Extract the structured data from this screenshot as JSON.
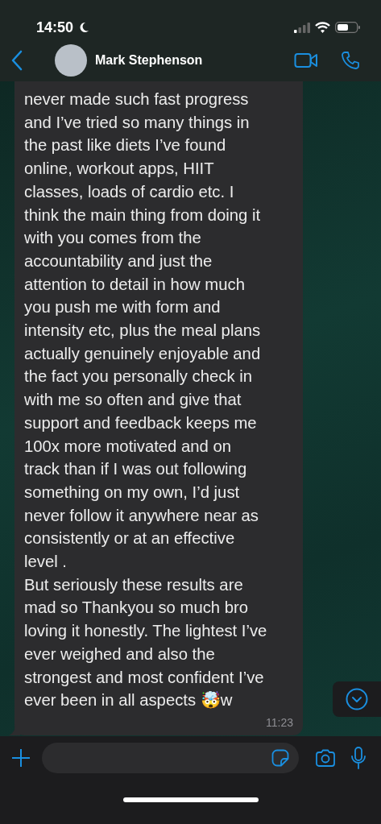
{
  "status_bar": {
    "time": "14:50"
  },
  "header": {
    "contact_name": "Mark Stephenson"
  },
  "message": {
    "lines": [
      "never made such fast progress",
      "and I’ve tried so many things in",
      "the past like diets I’ve found",
      "online, workout apps, HIIT",
      "classes, loads of cardio etc. I",
      "think the main thing from doing it",
      "with you comes from the",
      "accountability and just the",
      "attention to detail in how much",
      "you push me with form and",
      "intensity etc, plus the meal plans",
      "actually genuinely enjoyable and",
      "the fact you personally check in",
      "with me so often and give that",
      "support and feedback keeps me",
      "100x more motivated and on",
      "track than if I was out following",
      "something on my own, I’d just",
      "never follow it anywhere near as",
      "consistently or at an effective",
      "level .",
      "But seriously these results are",
      "mad so Thankyou so much bro",
      "loving it honestly. The lightest I’ve",
      "ever weighed and also the",
      "strongest and most confident I’ve",
      "ever been in all aspects 🤯w"
    ],
    "time": "11:23"
  }
}
